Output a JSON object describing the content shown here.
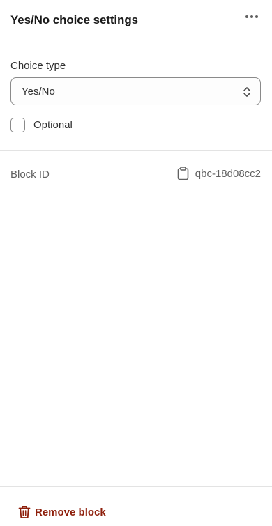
{
  "header": {
    "title": "Yes/No choice settings",
    "menu_icon": "more-horizontal-icon"
  },
  "choice": {
    "label": "Choice type",
    "selected": "Yes/No",
    "select_icon": "select-chevrons-icon",
    "optional_label": "Optional",
    "optional_checked": false
  },
  "block": {
    "id_label": "Block ID",
    "copy_icon": "clipboard-icon",
    "id_value": "qbc-18d08cc2"
  },
  "footer": {
    "remove_label": "Remove block",
    "remove_icon": "trash-icon",
    "danger_color": "#8e1f0b"
  }
}
